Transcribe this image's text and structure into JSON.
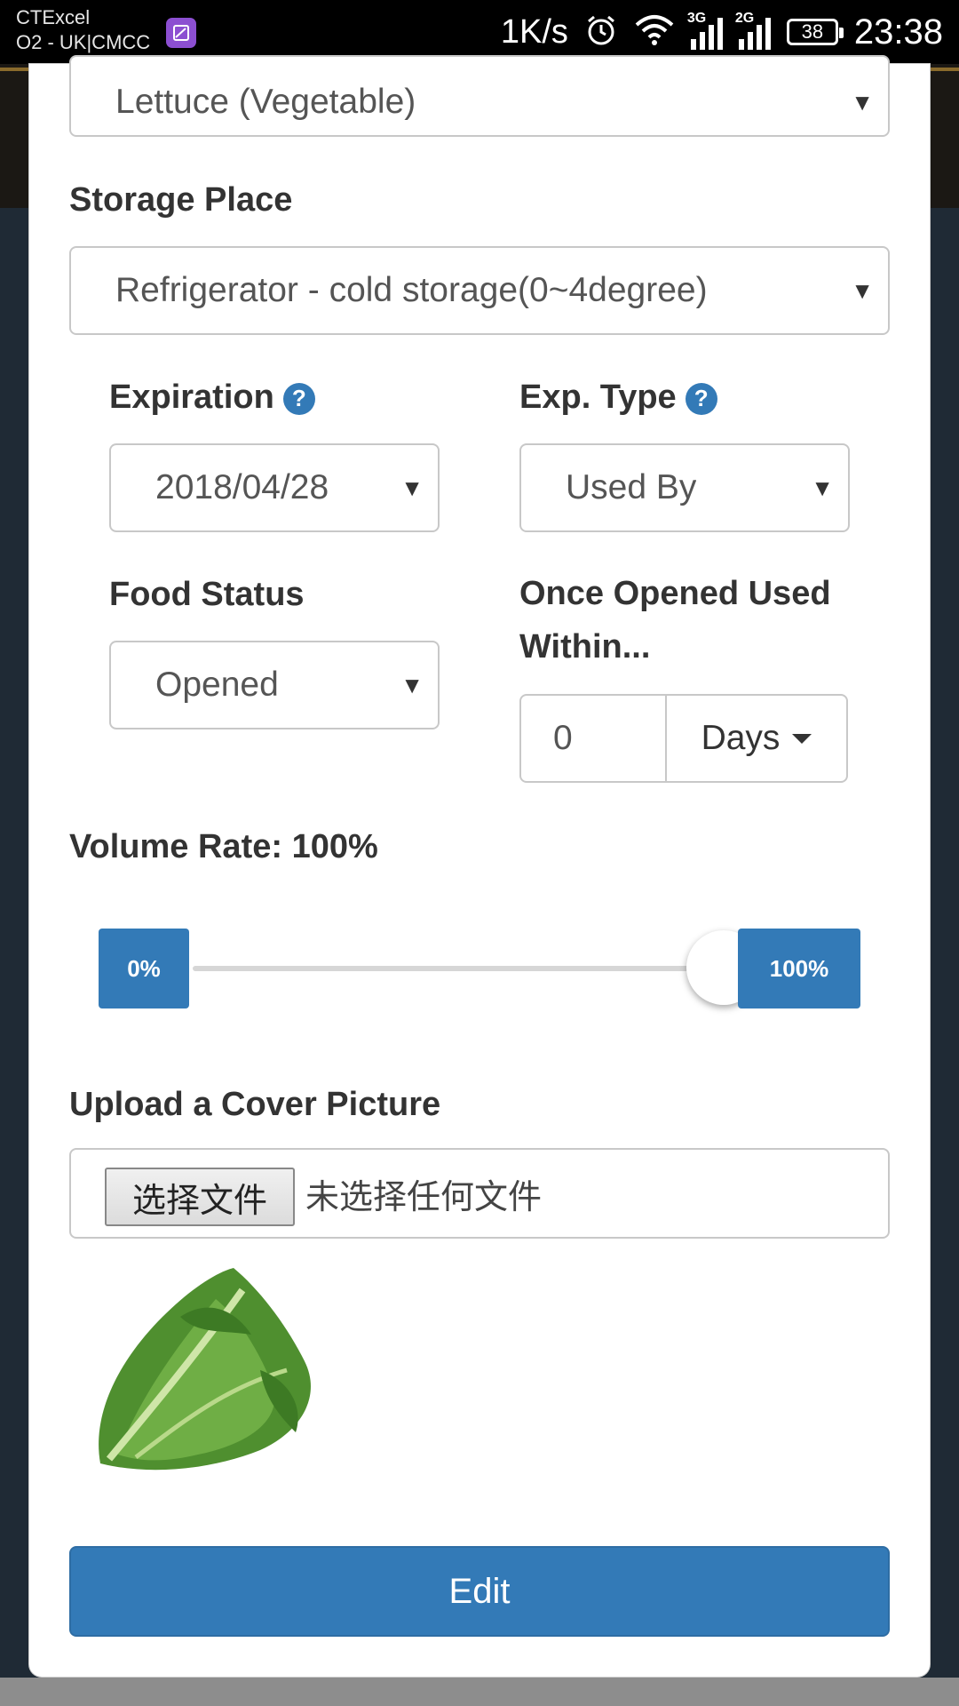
{
  "status_bar": {
    "carrier_line1": "CTExcel",
    "carrier_line2": "O2 - UK|CMCC",
    "net_speed": "1K/s",
    "net1": "3G",
    "net2": "2G",
    "battery": "38",
    "time": "23:38"
  },
  "form": {
    "food_type_value": "Lettuce (Vegetable)",
    "storage_label": "Storage Place",
    "storage_value": "Refrigerator - cold storage(0~4degree)",
    "expiration_label": "Expiration",
    "expiration_value": "2018/04/28",
    "exp_type_label": "Exp. Type",
    "exp_type_value": "Used By",
    "food_status_label": "Food Status",
    "food_status_value": "Opened",
    "opened_label": "Once Opened Used Within...",
    "opened_value": "0",
    "opened_unit": "Days",
    "help_glyph": "?",
    "volume_label": "Volume Rate: 100%",
    "volume_value": 100,
    "slider_min_label": "0%",
    "slider_max_label": "100%",
    "upload_label": "Upload a Cover Picture",
    "file_button": "选择文件",
    "file_status": "未选择任何文件",
    "edit_button": "Edit"
  },
  "colors": {
    "primary": "#337ab7",
    "lettuce": "#5a9a3a"
  },
  "icons": {
    "alarm": "alarm-icon",
    "wifi": "wifi-icon",
    "help": "help-icon",
    "lettuce": "lettuce-image"
  }
}
